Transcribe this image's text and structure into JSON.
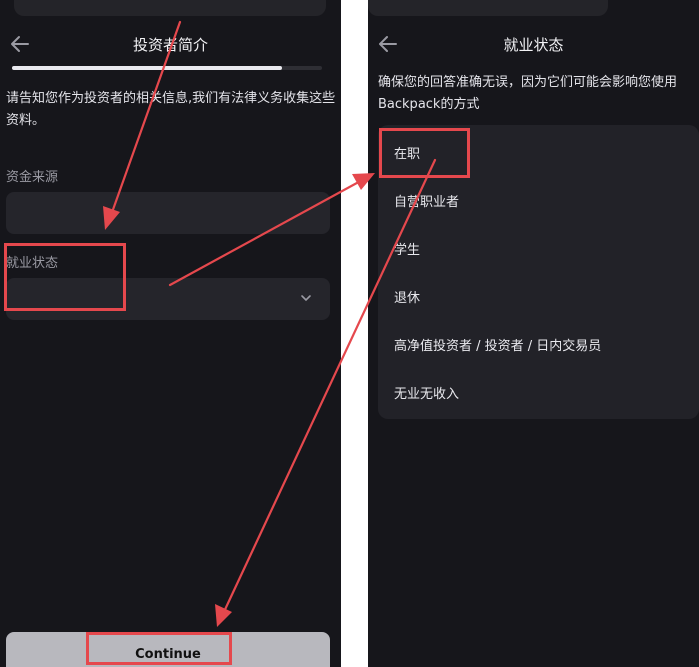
{
  "left": {
    "title": "投资者简介",
    "progress": 0.87,
    "description": "请告知您作为投资者的相关信息,我们有法律义务收集这些资料。",
    "source_label": "资金来源",
    "employment_label": "就业状态",
    "continue_label": "Continue"
  },
  "right": {
    "title": "就业状态",
    "description": "确保您的回答准确无误，因为它们可能会影响您使用Backpack的方式",
    "options": [
      "在职",
      "自营职业者",
      "学生",
      "退休",
      "高净值投资者 / 投资者 / 日内交易员",
      "无业无收入"
    ]
  },
  "colors": {
    "annotation": "#e5484d",
    "background": "#16161b",
    "field": "#25252b"
  },
  "icons": {
    "back": "arrow-left-icon",
    "dropdown": "chevron-down-icon"
  }
}
